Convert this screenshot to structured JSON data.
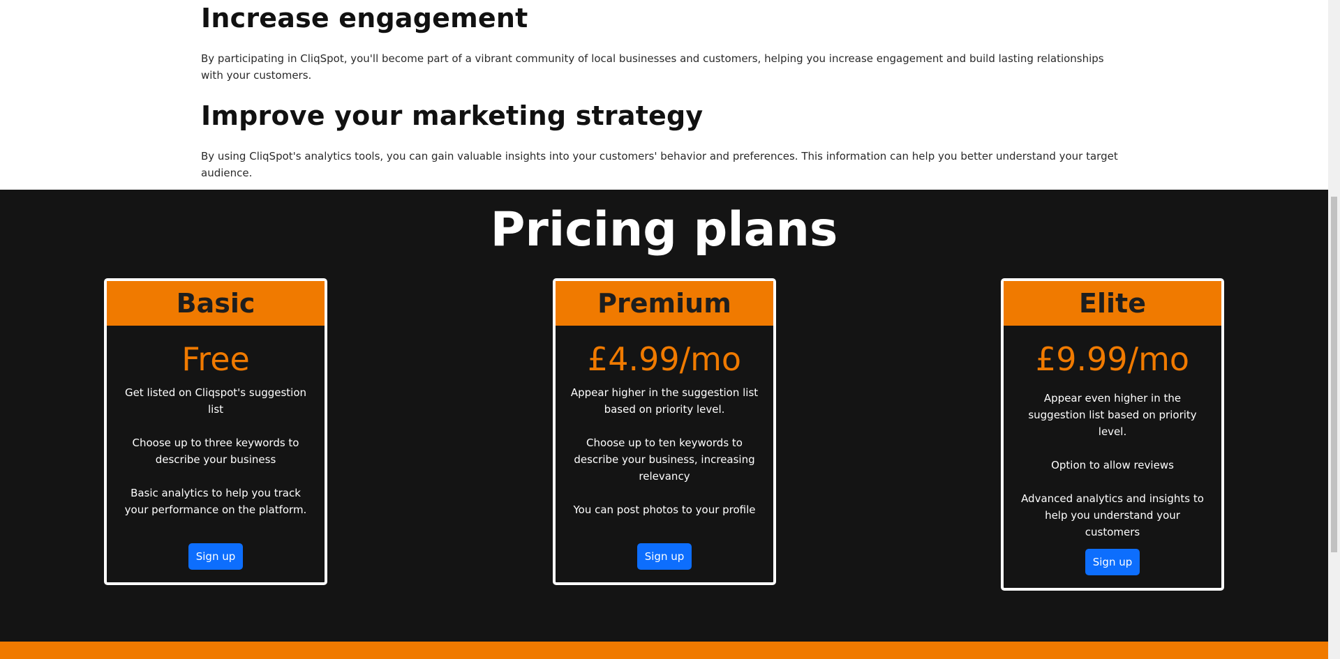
{
  "intro": {
    "section1_title": "Increase engagement",
    "section1_text": "By participating in CliqSpot, you'll become part of a vibrant community of local businesses and customers, helping you increase engagement and build lasting relationships with your customers.",
    "section2_title": "Improve your marketing strategy",
    "section2_text": "By using CliqSpot's analytics tools, you can gain valuable insights into your customers' behavior and preferences. This information can help you better understand your target audience."
  },
  "pricing": {
    "title": "Pricing plans",
    "plans": [
      {
        "name": "Basic",
        "price": "Free",
        "features": [
          "Get listed on Cliqspot's suggestion list",
          "Choose up to three keywords to describe your business",
          "Basic analytics to help you track your performance on the platform."
        ],
        "button": "Sign up"
      },
      {
        "name": "Premium",
        "price": "£4.99/mo",
        "features": [
          "Appear higher in the suggestion list based on priority level.",
          "Choose up to ten keywords to describe your business, increasing relevancy",
          "You can post photos to your profile"
        ],
        "button": "Sign up"
      },
      {
        "name": "Elite",
        "price": "£9.99/mo",
        "features": [
          "Appear even higher in the suggestion list based on priority level.",
          "Option to allow reviews",
          "Advanced analytics and insights to help you understand your customers"
        ],
        "button": "Sign up"
      }
    ]
  },
  "colors": {
    "accent_orange": "#f07a00",
    "dark_bg": "#141414",
    "button_blue": "#0d6efd"
  }
}
